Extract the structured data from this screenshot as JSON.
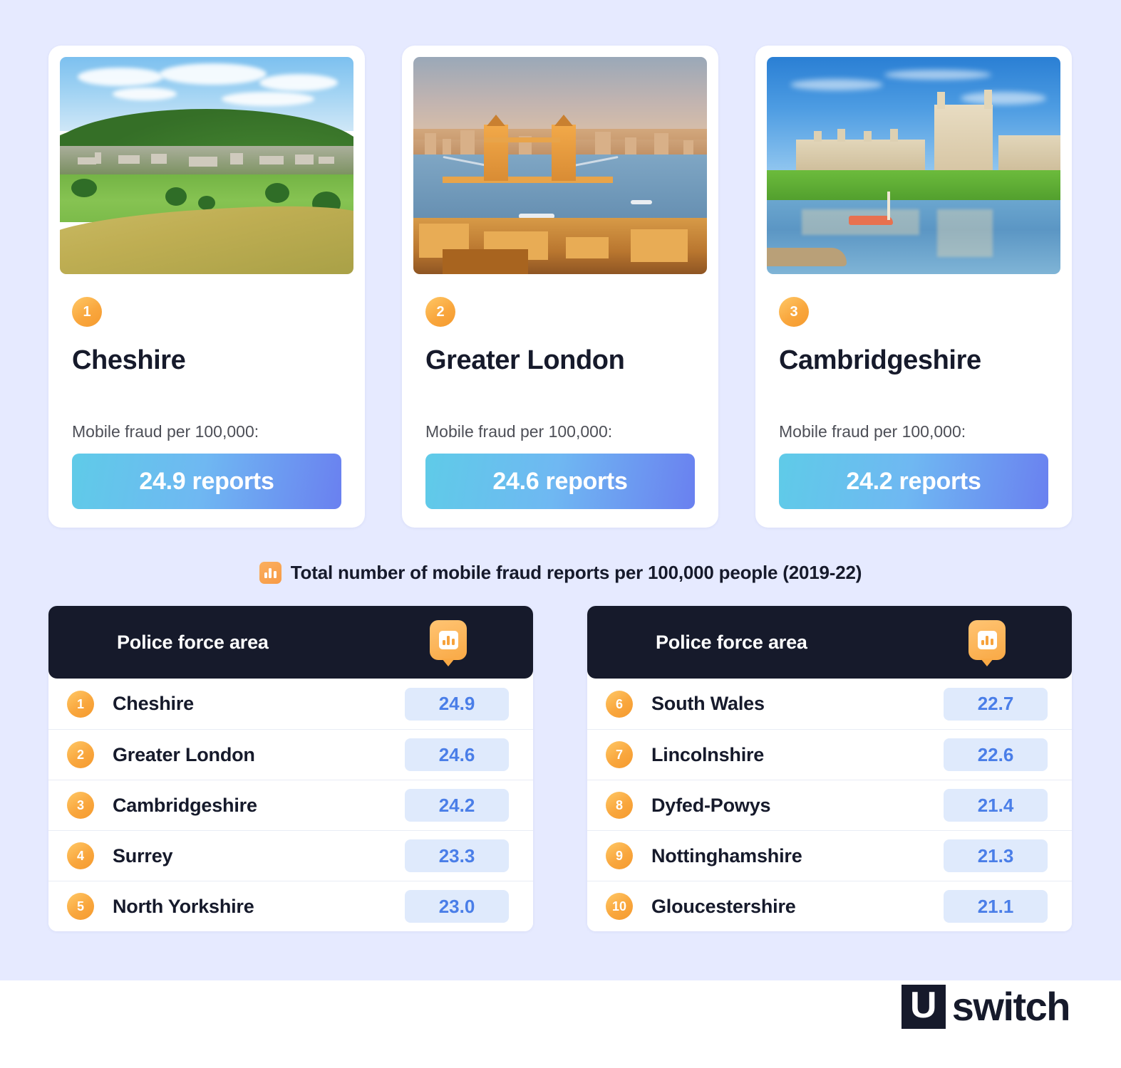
{
  "caption": {
    "icon": "bar-chart-icon",
    "text": "Total number of mobile fraud reports per 100,000 people (2019-22)"
  },
  "cards": [
    {
      "rank": "1",
      "title": "Cheshire",
      "subtitle": "Mobile fraud per 100,000:",
      "value_label": "24.9 reports",
      "photo_alt": "cheshire-countryside-photo"
    },
    {
      "rank": "2",
      "title": "Greater London",
      "subtitle": "Mobile fraud per 100,000:",
      "value_label": "24.6 reports",
      "photo_alt": "tower-bridge-london-photo"
    },
    {
      "rank": "3",
      "title": "Cambridgeshire",
      "subtitle": "Mobile fraud per 100,000:",
      "value_label": "24.2 reports",
      "photo_alt": "kings-college-cambridge-photo"
    }
  ],
  "tables": [
    {
      "header_label": "Police force area",
      "header_icon": "bar-chart-badge-icon",
      "rows": [
        {
          "rank": "1",
          "area": "Cheshire",
          "value": "24.9"
        },
        {
          "rank": "2",
          "area": "Greater London",
          "value": "24.6"
        },
        {
          "rank": "3",
          "area": "Cambridgeshire",
          "value": "24.2"
        },
        {
          "rank": "4",
          "area": "Surrey",
          "value": "23.3"
        },
        {
          "rank": "5",
          "area": "North Yorkshire",
          "value": "23.0"
        }
      ]
    },
    {
      "header_label": "Police force area",
      "header_icon": "bar-chart-badge-icon",
      "rows": [
        {
          "rank": "6",
          "area": "South Wales",
          "value": "22.7"
        },
        {
          "rank": "7",
          "area": "Lincolnshire",
          "value": "22.6"
        },
        {
          "rank": "8",
          "area": "Dyfed-Powys",
          "value": "21.4"
        },
        {
          "rank": "9",
          "area": "Nottinghamshire",
          "value": "21.3"
        },
        {
          "rank": "10",
          "area": "Gloucestershire",
          "value": "21.1"
        }
      ]
    }
  ],
  "footer": {
    "logo_mark": "U",
    "logo_word": "switch"
  },
  "colors": {
    "background": "#e6eaff",
    "card": "#ffffff",
    "dark": "#161a2b",
    "accent_orange": "#f9a73e",
    "pill_bg": "#dfeafc",
    "pill_text": "#4a7ee8",
    "gradient_from": "#5fcbe8",
    "gradient_to": "#6a80f0"
  },
  "chart_data": {
    "type": "bar",
    "title": "Total number of mobile fraud reports per 100,000 people (2019-22)",
    "xlabel": "Police force area",
    "ylabel": "Mobile fraud reports per 100,000 people",
    "categories": [
      "Cheshire",
      "Greater London",
      "Cambridgeshire",
      "Surrey",
      "North Yorkshire",
      "South Wales",
      "Lincolnshire",
      "Dyfed-Powys",
      "Nottinghamshire",
      "Gloucestershire"
    ],
    "values": [
      24.9,
      24.6,
      24.2,
      23.3,
      23.0,
      22.7,
      22.6,
      21.4,
      21.3,
      21.1
    ],
    "ranks": [
      1,
      2,
      3,
      4,
      5,
      6,
      7,
      8,
      9,
      10
    ],
    "ylim": [
      0,
      25
    ],
    "grid": false,
    "legend": "none"
  }
}
